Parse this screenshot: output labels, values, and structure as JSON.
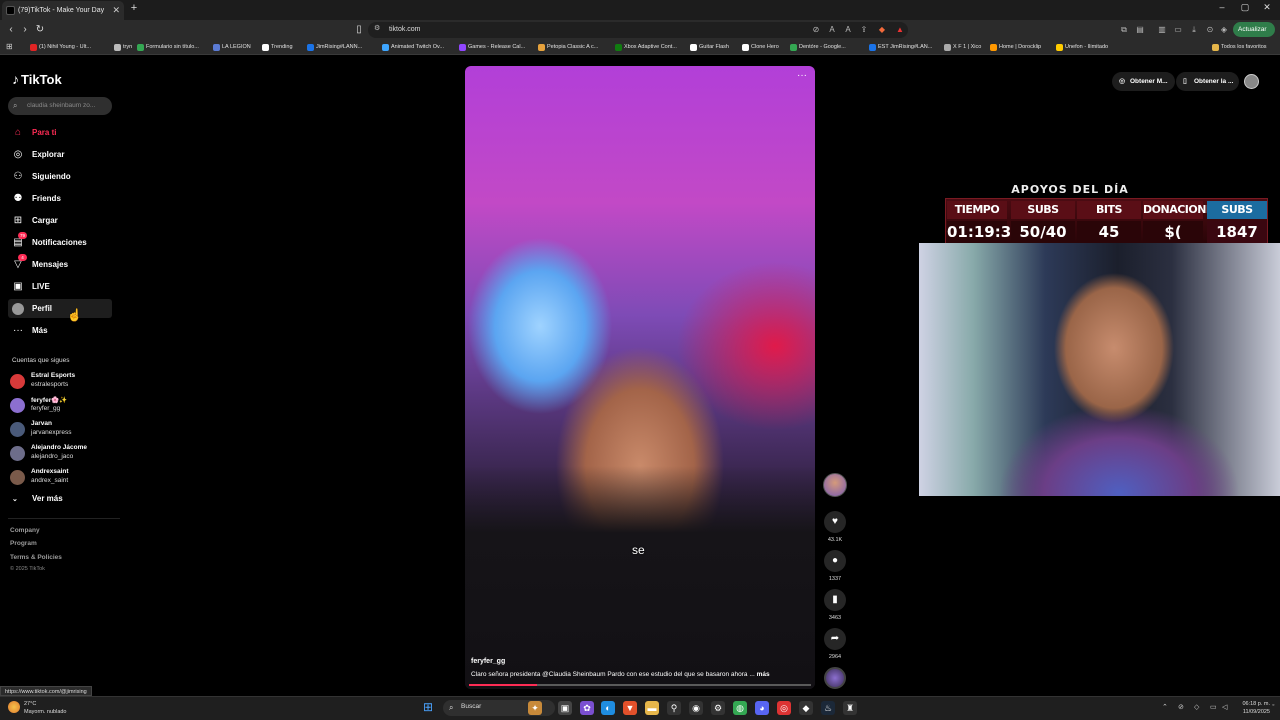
{
  "browser": {
    "tab_title": "(79)TikTok - Make Your Day",
    "url": "tiktok.com",
    "update_label": "Actualizar",
    "status_url": "https://www.tiktok.com/@jimrising",
    "bookmarks": [
      {
        "label": "(1) Nihil Young - Ult...",
        "color": "#e02424"
      },
      {
        "label": "tryn",
        "color": "#bbbbbb"
      },
      {
        "label": "Formulario sin título...",
        "color": "#34a853"
      },
      {
        "label": "LA LEGION",
        "color": "#5b7bd5"
      },
      {
        "label": "Trending",
        "color": "#ffffff"
      },
      {
        "label": "JimRising#LANN...",
        "color": "#1a73e8"
      },
      {
        "label": "Animated Twitch Ov...",
        "color": "#3ea6ff"
      },
      {
        "label": "Games - Release Cal...",
        "color": "#9146ff"
      },
      {
        "label": "Petopia Classic A c...",
        "color": "#e6a23c"
      },
      {
        "label": "Xbox Adaptive Cont...",
        "color": "#107c10"
      },
      {
        "label": "Guitar Flash",
        "color": "#ffffff"
      },
      {
        "label": "Clone Hero",
        "color": "#ffffff"
      },
      {
        "label": "Dentóre - Google...",
        "color": "#34a853"
      },
      {
        "label": "EST JimRising#LAN...",
        "color": "#1a73e8"
      },
      {
        "label": "X F 1 | Xico",
        "color": "#aaaaaa"
      },
      {
        "label": "Home | Dorocklip",
        "color": "#ff9800"
      },
      {
        "label": "Unefon - Ilimitado",
        "color": "#ffcc00"
      }
    ],
    "bookmarks_all": "Todos los favoritos"
  },
  "sidebar": {
    "logo": "TikTok",
    "search_placeholder": "claudia sheinbaum zo...",
    "nav": [
      {
        "label": "Para ti",
        "icon": "home-icon",
        "glyph": "⌂"
      },
      {
        "label": "Explorar",
        "icon": "compass-icon",
        "glyph": "◎"
      },
      {
        "label": "Siguiendo",
        "icon": "following-icon",
        "glyph": "⚇"
      },
      {
        "label": "Friends",
        "icon": "friends-icon",
        "glyph": "⚉"
      },
      {
        "label": "Cargar",
        "icon": "upload-icon",
        "glyph": "⊞"
      },
      {
        "label": "Notificaciones",
        "icon": "inbox-icon",
        "glyph": "▤",
        "badge": "79"
      },
      {
        "label": "Mensajes",
        "icon": "send-icon",
        "glyph": "▽",
        "badge": "4"
      },
      {
        "label": "LIVE",
        "icon": "live-icon",
        "glyph": "▣"
      },
      {
        "label": "Perfil",
        "icon": "profile-avatar-icon",
        "glyph": "●"
      },
      {
        "label": "Más",
        "icon": "more-icon",
        "glyph": "···"
      }
    ],
    "following_heading": "Cuentas que sigues",
    "accounts": [
      {
        "name": "Estral Esports",
        "handle": "estralesports",
        "color": "#d83a3a"
      },
      {
        "name": "feryfer🌸✨",
        "handle": "feryfer_gg",
        "color": "#8c6fd0"
      },
      {
        "name": "Jarvan",
        "handle": "jarvanexpress",
        "color": "#4a5a7a"
      },
      {
        "name": "Alejandro Jácome",
        "handle": "alejandro_jaco",
        "color": "#6d6d8a"
      },
      {
        "name": "Andrexsaint",
        "handle": "andrex_saint",
        "color": "#7a5a4a"
      }
    ],
    "see_more": "Ver más",
    "footer": [
      "Company",
      "Program",
      "Terms & Policies"
    ],
    "copyright": "© 2025 TikTok"
  },
  "header_buttons": [
    "Obtener M...",
    "Obtener la ..."
  ],
  "video": {
    "caption_word": "se",
    "username": "feryfer_gg",
    "description": "Claro señora presidenta @Claudia Sheinbaum Pardo  con ese estudio del que se basaron ahora ...",
    "more_label": "más",
    "progress": 0.2,
    "likes": "43.1K",
    "comments": "1337",
    "saves": "3463",
    "shares": "2964"
  },
  "stream_overlay": {
    "title": "APOYOS DEL DÍA",
    "headers": [
      "TIEMPO",
      "SUBS",
      "BITS",
      "DONACIONES",
      "SUBS TOTAL"
    ],
    "values": [
      "01:19:32",
      "50/40",
      "45",
      "$(",
      "1847"
    ]
  },
  "taskbar": {
    "temperature": "27°C",
    "weather": "Mayorm. nublado",
    "search_label": "Buscar",
    "time": "06:18 p. m.",
    "date": "11/09/2025"
  }
}
